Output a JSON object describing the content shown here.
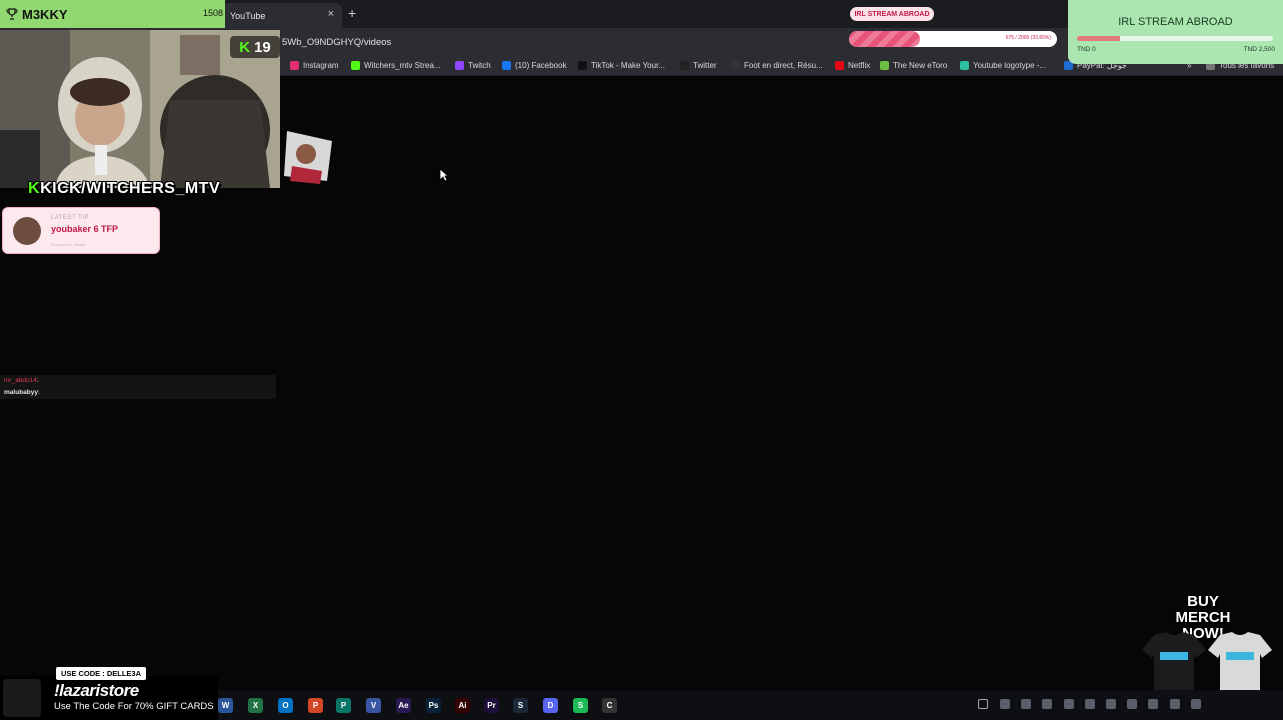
{
  "alert": {
    "title": "M3KKY",
    "count": "1508",
    "icon": "trophy-icon"
  },
  "browser": {
    "tab_title": "YouTube",
    "close_glyph": "×",
    "new_tab_glyph": "+",
    "url": "5Wb_O9NDGHYQ/videos",
    "bookmarks": [
      {
        "label": "Instagram",
        "icon": "instagram-icon",
        "color": "#e1306c"
      },
      {
        "label": "Witchers_mtv Strea...",
        "icon": "kick-icon",
        "color": "#53fc18"
      },
      {
        "label": "Twitch",
        "icon": "twitch-icon",
        "color": "#9146ff"
      },
      {
        "label": "(10) Facebook",
        "icon": "facebook-icon",
        "color": "#1877f2"
      },
      {
        "label": "TikTok - Make Your...",
        "icon": "tiktok-icon",
        "color": "#111111"
      },
      {
        "label": "Twitter",
        "icon": "x-icon",
        "color": "#222222"
      },
      {
        "label": "Foot en direct, Résu...",
        "icon": "foot-icon",
        "color": "#333333"
      },
      {
        "label": "Netflix",
        "icon": "netflix-icon",
        "color": "#e50914"
      },
      {
        "label": "The New eToro",
        "icon": "etoro-icon",
        "color": "#6ebe45"
      },
      {
        "label": "Youtube logotype -...",
        "icon": "vector-icon",
        "color": "#2cc1a0"
      },
      {
        "label": "PayPal: جوجل",
        "icon": "paypal-icon",
        "color": "#1f6bd1"
      },
      {
        "label": "»",
        "icon": "more-icon",
        "color": "#2b2d33"
      },
      {
        "label": "Tous les favoris",
        "icon": "folder-icon",
        "color": "#777777"
      }
    ]
  },
  "overlay": {
    "kick_count": "19",
    "kick_letter": "K",
    "channel_prefix": "K",
    "channel_name": "KICK/WITCHERS_MTV",
    "tip": {
      "label": "LATEST TIP",
      "value": "youbaker 6 TFP",
      "sub": "Powered by Tebble"
    },
    "chat": [
      {
        "user": "mr_abdo14",
        "text": ": ",
        "color": "#e03a52"
      },
      {
        "user": "malubabyy",
        "text": ": ",
        "color": "#e6e6e6"
      }
    ],
    "goal_pill": "IRL STREAM ABROAD",
    "goal_bar_text": "675 / 2000 (33.65%)",
    "goal_bar_progress": 0.34,
    "goal_card": {
      "title": "IRL STREAM ABROAD",
      "low": "TND 0",
      "high": "TND 2,500",
      "progress": 0.22
    },
    "merch": {
      "line1": "BUY MERCH",
      "line2": "NOW!"
    },
    "promo": {
      "code": "USE CODE : DELLE3A",
      "name": "!lazaristore",
      "line": "Use The Code For 70% GIFT CARDS"
    }
  },
  "taskbar": {
    "apps": [
      {
        "label": "W",
        "name": "word-icon",
        "color": "#2b579a"
      },
      {
        "label": "X",
        "name": "excel-icon",
        "color": "#217346"
      },
      {
        "label": "O",
        "name": "outlook-icon",
        "color": "#0072c6"
      },
      {
        "label": "P",
        "name": "powerpoint-icon",
        "color": "#d24726"
      },
      {
        "label": "P",
        "name": "publisher-icon",
        "color": "#077568"
      },
      {
        "label": "V",
        "name": "visio-icon",
        "color": "#3955a3"
      },
      {
        "label": "Ae",
        "name": "aftereffects-icon",
        "color": "#2a1a53"
      },
      {
        "label": "Ps",
        "name": "photoshop-icon",
        "color": "#0a2239"
      },
      {
        "label": "Ai",
        "name": "illustrator-icon",
        "color": "#330000"
      },
      {
        "label": "Pr",
        "name": "premiere-icon",
        "color": "#1d0f3a"
      },
      {
        "label": "S",
        "name": "steam-icon",
        "color": "#1b2838"
      },
      {
        "label": "D",
        "name": "discord-icon",
        "color": "#5865f2"
      },
      {
        "label": "S",
        "name": "spotify-icon",
        "color": "#1db954"
      },
      {
        "label": "C",
        "name": "chrome-icon",
        "color": "#333333"
      }
    ]
  }
}
